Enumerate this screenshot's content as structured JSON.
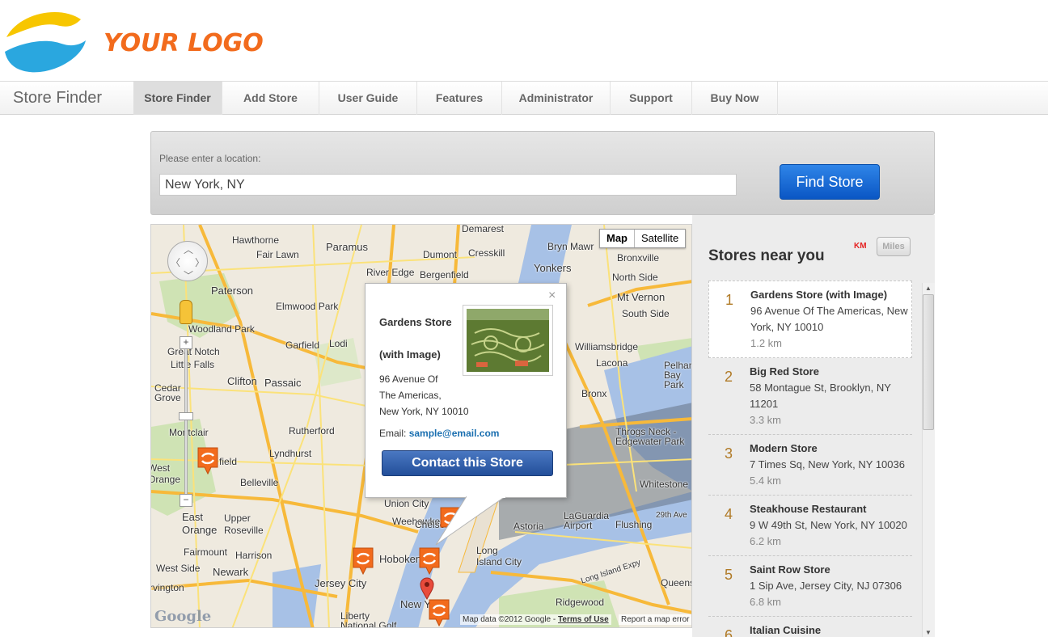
{
  "logo": {
    "text": "YOUR LOGO",
    "colors": {
      "yellow": "#f7c600",
      "blue": "#2aa7df",
      "orange": "#f26b1d"
    }
  },
  "nav": {
    "brand": "Store Finder",
    "tabs": [
      {
        "label": "Store Finder",
        "active": true
      },
      {
        "label": "Add Store"
      },
      {
        "label": "User Guide"
      },
      {
        "label": "Features"
      },
      {
        "label": "Administrator"
      },
      {
        "label": "Support"
      },
      {
        "label": "Buy Now"
      }
    ]
  },
  "search": {
    "label": "Please enter a location:",
    "value": "New York, NY",
    "button": "Find Store",
    "accent": "#0a56c4"
  },
  "map": {
    "type_map": "Map",
    "type_satellite": "Satellite",
    "labels": {
      "hawthorne": "Hawthorne",
      "paramus": "Paramus",
      "demarest": "Demarest",
      "bryn_mawr": "Bryn Mawr",
      "yonkers": "Yonkers",
      "fair_lawn": "Fair Lawn",
      "dumont": "Dumont",
      "cresskill": "Cresskill",
      "bronxville": "Bronxville",
      "river_edge": "River Edge",
      "bergenfield": "Bergenfield",
      "paterson": "Paterson",
      "elmwood_park": "Elmwood Park",
      "mt_vernon": "Mt Vernon",
      "north_side": "North Side",
      "south_side": "South Side",
      "woodland_park": "Woodland Park",
      "garfield": "Garfield",
      "lodi": "Lodi",
      "great_notch": "Great Notch",
      "little_falls": "Little Falls",
      "williamsbridge": "Williamsbridge",
      "lacona": "Lacona",
      "clifton": "Clifton",
      "passaic": "Passaic",
      "pelham_bay_park": "Pelham Bay Park",
      "cedar_grove": "Cedar Grove",
      "bronx": "Bronx",
      "rutherford": "Rutherford",
      "throgs_neck": "Throgs Neck - Edgewater Park",
      "montclair": "Montclair",
      "bloomfield": "field",
      "lyndhurst": "Lyndhurst",
      "belleville": "Belleville",
      "whitestone": "Whitestone",
      "west_orange": "West Orange",
      "east_orange": "East Orange",
      "upper_roseville": "Upper Roseville",
      "union_city": "Union City",
      "weehawken": "Weehawken",
      "laguardia": "LaGuardia Airport",
      "flushing": "Flushing",
      "astoria": "Astoria",
      "chelsea": "Chelsea",
      "fairmount": "Fairmount",
      "harrison": "Harrison",
      "hoboken": "Hoboken",
      "long_island_city": "Long Island City",
      "west_side": "West Side",
      "newark": "Newark",
      "jersey_city": "Jersey City",
      "queens": "Queens",
      "irvington": "rvington",
      "new_york": "New York",
      "ridgewood": "Ridgewood",
      "liberty_national": "Liberty National Golf Course",
      "lic_expy": "Long Island Expy",
      "ave_29th": "29th Ave"
    },
    "attribution": "Map data ©2012 Google -",
    "terms": "Terms of Use",
    "report": "Report a map error",
    "google": "Google"
  },
  "info_window": {
    "title_line1": "Gardens Store",
    "title_line2": "(with Image)",
    "address_lines": [
      "96 Avenue Of",
      "The Americas,",
      "New York, NY 10010"
    ],
    "email_label": "Email:",
    "email": "sample@email.com",
    "button": "Contact this Store",
    "close": "×"
  },
  "results": {
    "title": "Stores near you",
    "unit_km": "KM",
    "unit_miles": "Miles",
    "items": [
      {
        "num": "1",
        "name": "Gardens Store (with Image)",
        "address": "96 Avenue Of The Americas, New York, NY 10010",
        "distance": "1.2 km"
      },
      {
        "num": "2",
        "name": "Big Red Store",
        "address": "58 Montague St, Brooklyn, NY 11201",
        "distance": "3.3 km"
      },
      {
        "num": "3",
        "name": "Modern Store",
        "address": "7 Times Sq, New York, NY 10036",
        "distance": "5.4 km"
      },
      {
        "num": "4",
        "name": "Steakhouse Restaurant",
        "address": "9 W 49th St, New York, NY 10020",
        "distance": "6.2 km"
      },
      {
        "num": "5",
        "name": "Saint Row Store",
        "address": "1 Sip Ave, Jersey City, NJ 07306",
        "distance": "6.8 km"
      },
      {
        "num": "6",
        "name": "Italian Cuisine",
        "address": "",
        "distance": ""
      }
    ]
  }
}
